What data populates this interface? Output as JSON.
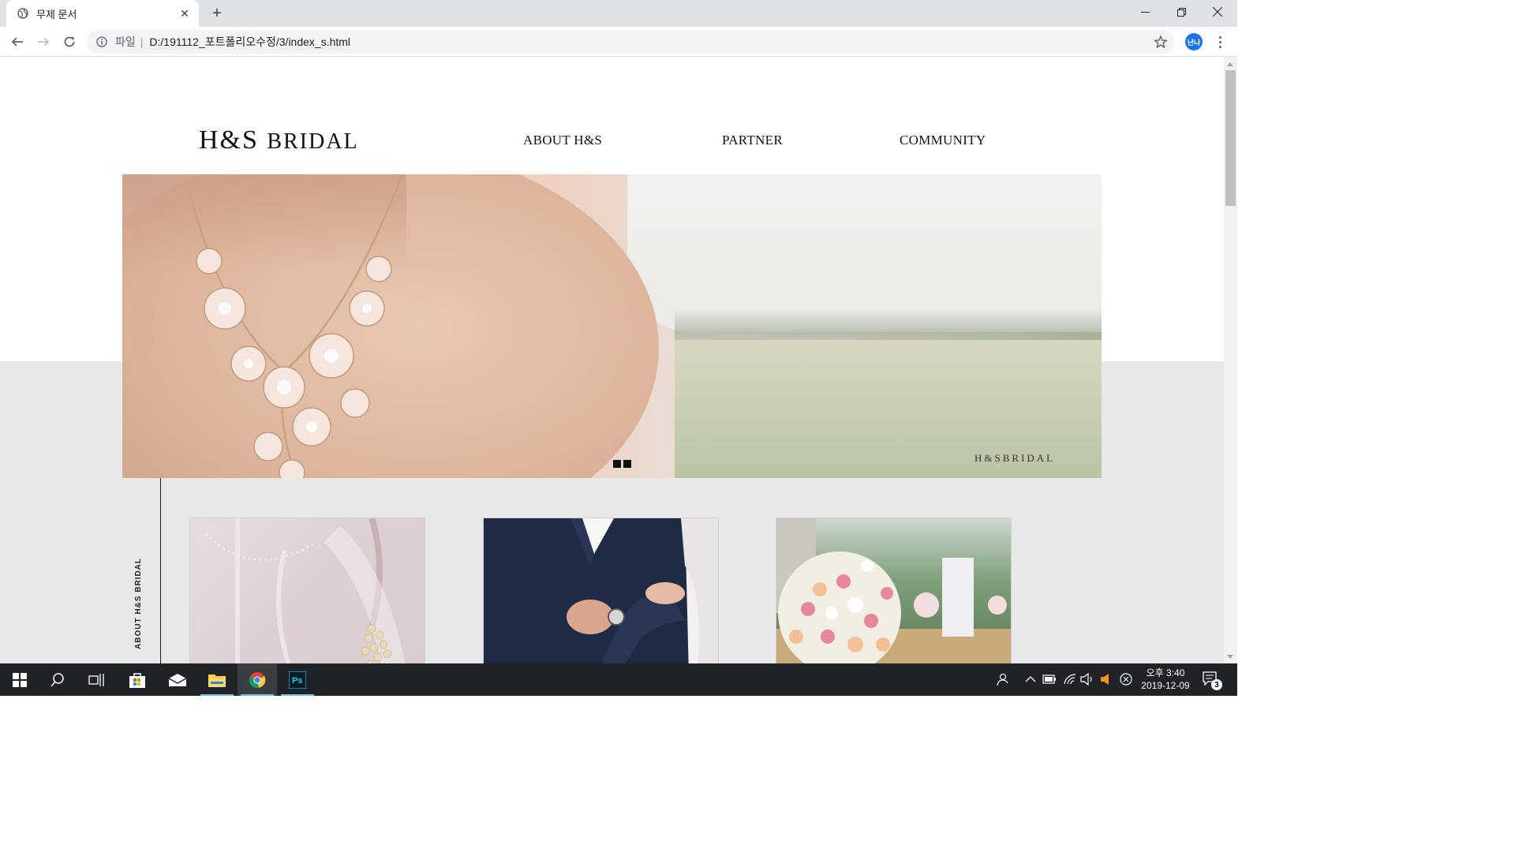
{
  "browser": {
    "tab_title": "무제 문서",
    "address_scheme": "파일",
    "address_url": "D:/191112_포트폴리오수정/3/index_s.html",
    "profile_initial": "난나"
  },
  "site": {
    "logo_main": "H&S",
    "logo_sub": "BRIDAL",
    "nav": [
      "ABOUT H&S",
      "PARTNER",
      "COMMUNITY"
    ],
    "hero_caption": "H&SBRIDAL",
    "slider_dots": 2,
    "section_label": "ABOUT  H&S BRIDAL"
  },
  "taskbar": {
    "clock_time": "오후 3:40",
    "clock_date": "2019-12-09",
    "notification_count": "3",
    "apps": [
      "windows-start",
      "search",
      "task-view",
      "microsoft-store",
      "mail",
      "file-explorer",
      "chrome",
      "photoshop"
    ]
  },
  "colors": {
    "accent_blue": "#1a73e8",
    "page_gray": "#e8e8e8",
    "taskbar": "#1f2226"
  }
}
